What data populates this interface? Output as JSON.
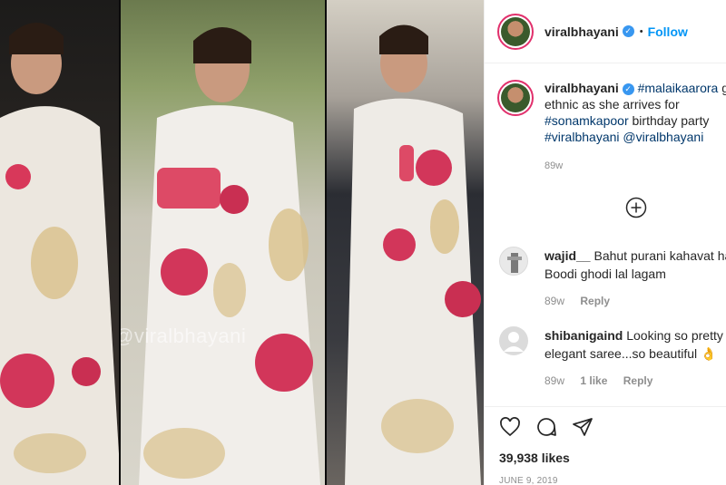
{
  "post": {
    "watermark": "@viralbhayani",
    "header": {
      "username": "viralbhayani",
      "dot": "•",
      "follow_label": "Follow"
    },
    "caption": {
      "username": "viralbhayani",
      "line1_tag": "#malaikaarora",
      "line1_rest": " go",
      "line2": "ethnic as she arrives for",
      "line3_tag": "#sonamkapoor",
      "line3_rest": " birthday party",
      "line4_tag1": "#viralbhayani",
      "line4_tag2": "@viralbhayani",
      "time": "89w"
    },
    "comments": [
      {
        "username": "wajid__",
        "text_line1": "Bahut purani kahavat hai",
        "text_line2": "Boodi ghodi lal lagam",
        "time": "89w",
        "likes": "",
        "reply": "Reply"
      },
      {
        "username": "shibanigaind",
        "text_line1": "Looking so pretty i",
        "text_line2": "elegant saree...so beautiful 👌",
        "time": "89w",
        "likes": "1 like",
        "reply": "Reply"
      }
    ],
    "likes": "39,938 likes",
    "date": "JUNE 9, 2019"
  },
  "icons": {
    "verified": "verified-badge",
    "add_comment": "plus-circle-icon",
    "like": "heart-icon",
    "comment": "comment-bubble-icon",
    "share": "paper-plane-icon"
  },
  "colors": {
    "accent": "#0095f6",
    "verified": "#3897f0",
    "story_ring": "#e1306c",
    "tag_link": "#00376b",
    "muted": "#8e8e8e"
  }
}
